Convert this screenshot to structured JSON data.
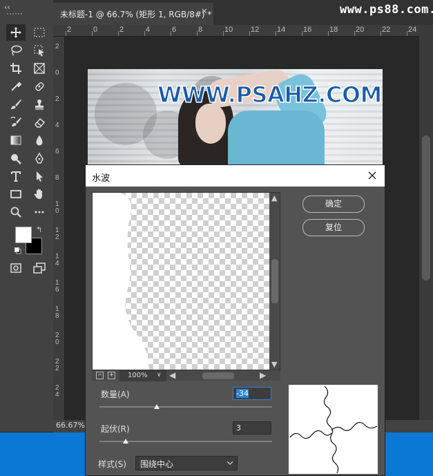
{
  "document_tab": {
    "title": "未标题-1 @ 66.7% (矩形 1, RGB/8#) *",
    "close": "×"
  },
  "watermark": "www.ps88.com.cn",
  "ruler": {
    "top_labels": [
      "2",
      "0",
      "2",
      "4",
      "6",
      "8",
      "10",
      "12",
      "14",
      "16",
      "18",
      "20",
      "22",
      "24"
    ],
    "left_labels": [
      "2",
      "0",
      "2",
      "4",
      "6",
      "8",
      "1\n0",
      "1\n2",
      "1\n4",
      "1\n6",
      "1\n8",
      "2\n0",
      "2\n2",
      "2\n4"
    ]
  },
  "status": {
    "zoom": "66.67%"
  },
  "image": {
    "banner_text": "WWW.PSAHZ.COM",
    "banner_color": "#1a5ca8"
  },
  "toolbar": {
    "grip": "‹‹",
    "tools": [
      "move-tool-icon",
      "artboard-marquee-icon",
      "lasso-icon",
      "object-select-icon",
      "crop-icon",
      "frame-icon",
      "eyedropper-icon",
      "healing-brush-icon",
      "brush-icon",
      "clone-stamp-icon",
      "history-brush-icon",
      "eraser-icon",
      "gradient-icon",
      "blur-icon",
      "dodge-icon",
      "pen-icon",
      "type-icon",
      "path-select-icon",
      "rectangle-icon",
      "hand-icon",
      "zoom-icon",
      "more-tools-icon",
      "quick-mask-icon",
      "screen-mode-icon"
    ],
    "foreground_color": "#ffffff",
    "background_color": "#000000"
  },
  "dialog": {
    "title": "水波",
    "ok_label": "确定",
    "reset_label": "复位",
    "preview_zoom": "100%",
    "amount_label": "数量(A)",
    "amount_value": "-34",
    "amount_position": 0.33,
    "ridges_label": "起伏(R)",
    "ridges_value": "3",
    "ridges_position": 0.15,
    "style_label": "样式(S)",
    "style_value": "围绕中心"
  },
  "colors": {
    "accent": "#2f82d6",
    "taskbar": "#0a78d4",
    "panel": "#535353"
  }
}
